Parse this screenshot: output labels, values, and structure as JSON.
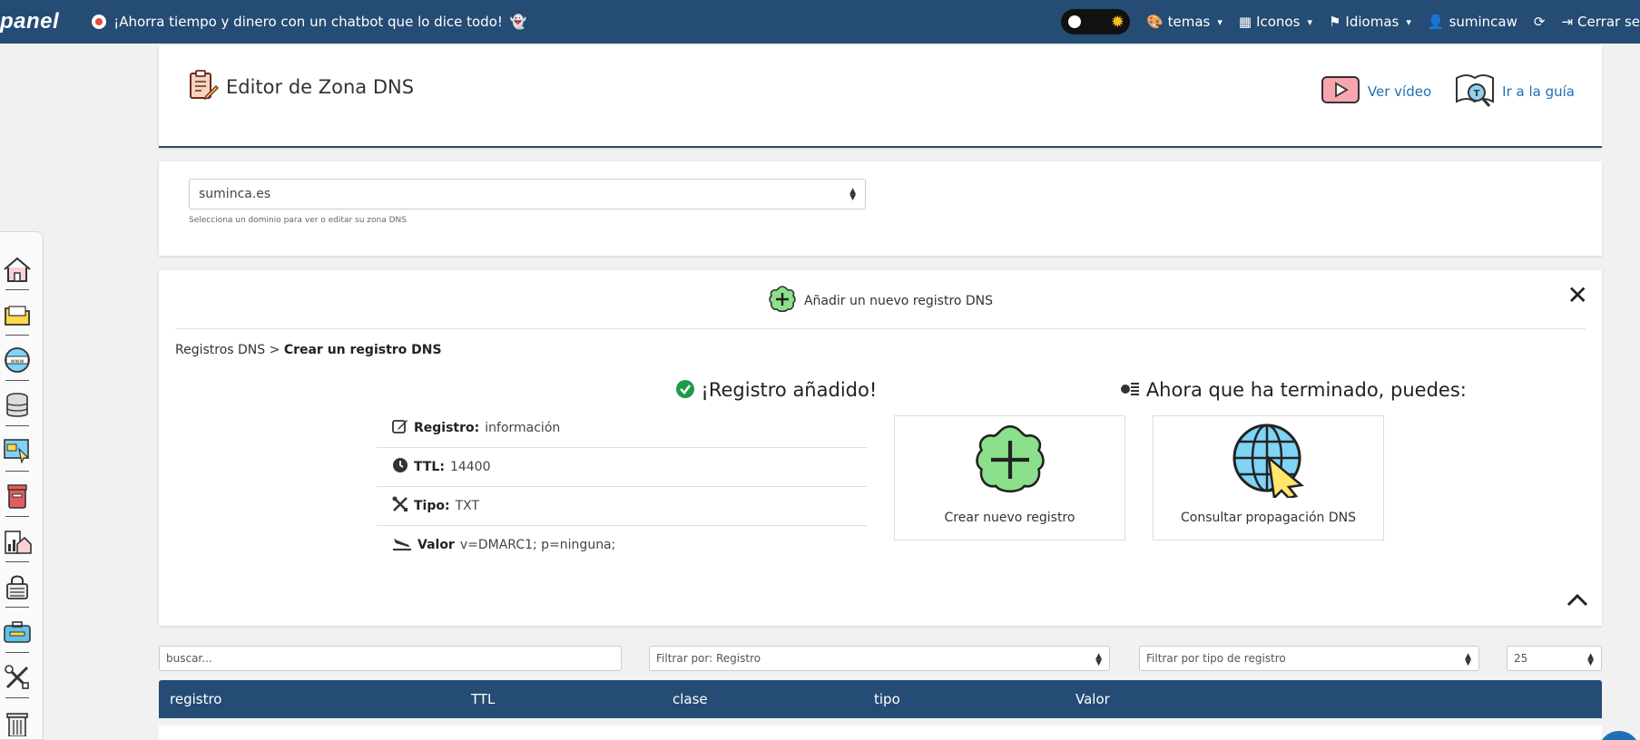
{
  "topbar": {
    "logo": "panel",
    "promo_text": "¡Ahorra tiempo y dinero con un chatbot que lo dice todo!",
    "themes_label": "temas",
    "icons_label": "Iconos",
    "languages_label": "Idiomas",
    "user_label": "sumincaw",
    "logout_label": "Cerrar se",
    "colors": {
      "bar": "#244c74",
      "sun": "#f7c11a"
    }
  },
  "header": {
    "title": "Editor de Zona DNS",
    "video_link": "Ver vídeo",
    "guide_link": "Ir a la guía"
  },
  "domain_select": {
    "value": "suminca.es",
    "hint": "Selecciona un dominio para ver o editar su zona DNS"
  },
  "add_panel": {
    "header": "Añadir un nuevo registro DNS",
    "breadcrumb_root": "Registros DNS",
    "breadcrumb_sep": ">",
    "breadcrumb_current": "Crear un registro DNS",
    "success_title": "¡Registro añadido!",
    "next_title": "Ahora que ha terminado, puedes:",
    "details": [
      {
        "icon": "edit-icon",
        "label": "Registro:",
        "value": "información"
      },
      {
        "icon": "clock-icon",
        "label": "TTL:",
        "value": "14400"
      },
      {
        "icon": "tools-icon",
        "label": "Tipo:",
        "value": "TXT"
      },
      {
        "icon": "plane-landing-icon",
        "label": "Valor",
        "value": "v=DMARC1; p=ninguna;"
      }
    ],
    "actions": [
      {
        "icon": "plus-flower-icon",
        "label": "Crear nuevo registro"
      },
      {
        "icon": "globe-cursor-icon",
        "label": "Consultar propagación DNS"
      }
    ]
  },
  "filters": {
    "search_placeholder": "buscar...",
    "filter_by": "Filtrar por: Registro",
    "filter_type": "Filtrar por tipo de registro",
    "page_size": "25"
  },
  "table": {
    "headers": [
      "registro",
      "TTL",
      "clase",
      "tipo",
      "Valor"
    ]
  },
  "sidebar": {
    "items": [
      "home-icon",
      "folder-icon",
      "www-globe-icon",
      "database-icon",
      "web-cursor-icon",
      "mailbox-icon",
      "stats-house-icon",
      "security-lock-icon",
      "toolbox-icon",
      "tools-cross-icon",
      "trash-icon"
    ]
  }
}
